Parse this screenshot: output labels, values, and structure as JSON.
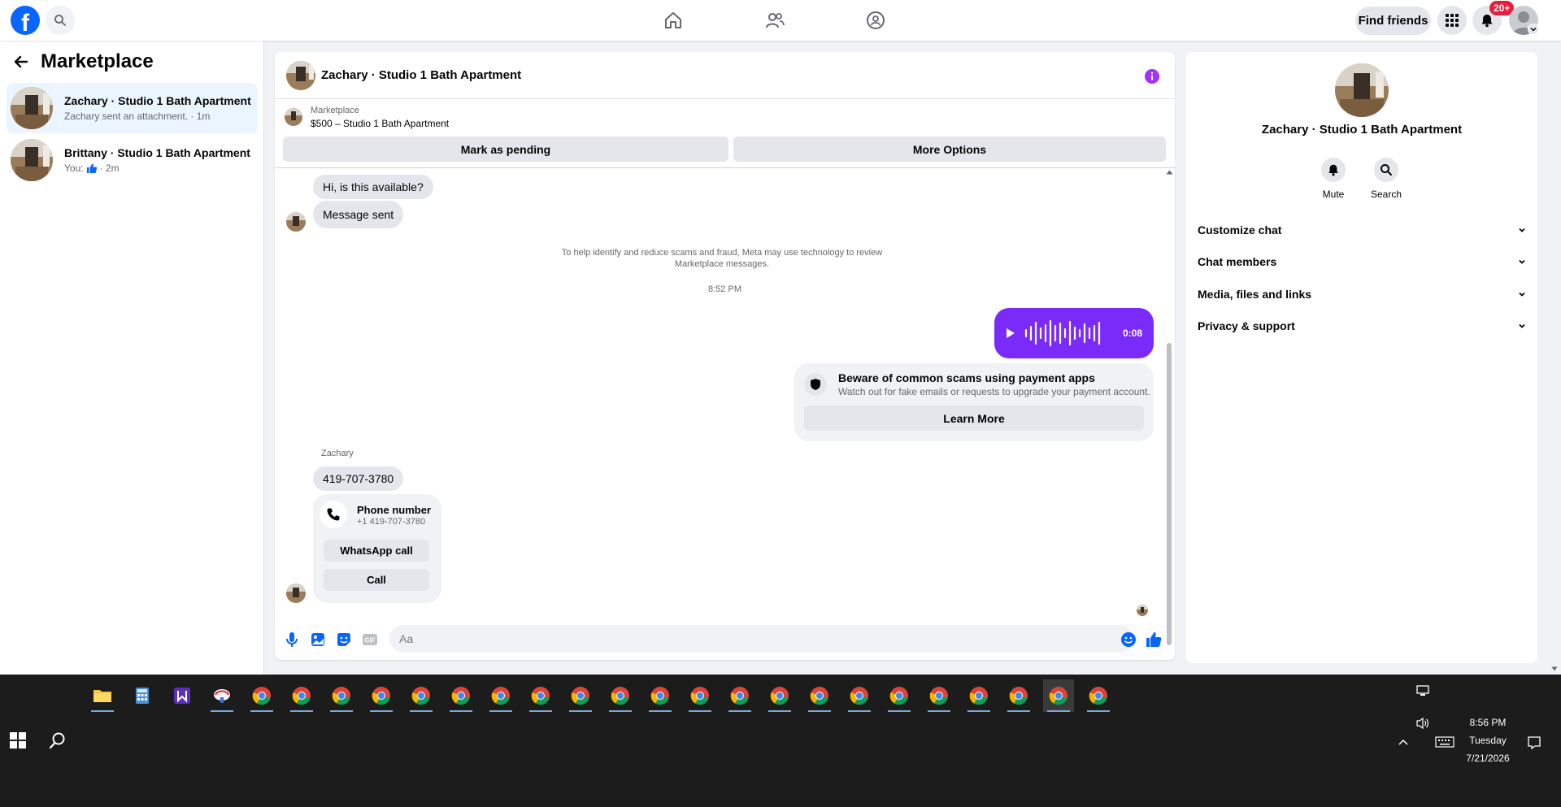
{
  "topbar": {
    "logo": "f",
    "notifications_badge": "20+",
    "find_friends_label": "Find friends",
    "icons": [
      "facebook-logo",
      "search-icon",
      "home-icon",
      "friends-icon",
      "groups-icon",
      "menu-grid-icon",
      "bell-icon",
      "profile-avatar"
    ]
  },
  "sidebar": {
    "title": "Marketplace",
    "conversations": [
      {
        "name": "Zachary · Studio 1 Bath Apartment",
        "preview": "Zachary sent an attachment. · 1m",
        "active": true
      },
      {
        "name": "Brittany · Studio 1 Bath Apartment",
        "preview_prefix": "You:",
        "preview_suffix": "· 2m",
        "active": false
      }
    ]
  },
  "chat": {
    "title": "Zachary · Studio 1 Bath Apartment",
    "listing": {
      "label": "Marketplace",
      "price_title": "$500 – Studio 1 Bath Apartment",
      "mark_pending_label": "Mark as pending",
      "more_options_label": "More Options"
    },
    "messages": {
      "first": "Hi, is this available?",
      "second": "Message sent",
      "notice": "To help identify and reduce scams and fraud, Meta may use technology to review Marketplace messages.",
      "timestamp": "8:52 PM",
      "voice_duration": "0:08",
      "scam_title": "Beware of common scams using payment apps",
      "scam_sub": "Watch out for fake emails or requests to upgrade your payment account.",
      "learn_more_label": "Learn More",
      "sender": "Zachary",
      "phone_text": "419-707-3780",
      "phone_card_title": "Phone number",
      "phone_card_number": "+1 419-707-3780",
      "whatsapp_label": "WhatsApp call",
      "call_label": "Call"
    },
    "composer": {
      "placeholder": "Aa"
    }
  },
  "details": {
    "name": "Zachary · Studio 1 Bath Apartment",
    "mute_label": "Mute",
    "search_label": "Search",
    "sections": [
      "Customize chat",
      "Chat members",
      "Media, files and links",
      "Privacy & support"
    ]
  },
  "taskbar": {
    "time": "8:56 PM",
    "day": "Tuesday",
    "date": "7/21/2026"
  },
  "colors": {
    "facebook_blue": "#0866ff",
    "messenger_purple": "#7b2bf9",
    "badge_red": "#e41e3f",
    "active_conversation": "#ebf5ff"
  }
}
